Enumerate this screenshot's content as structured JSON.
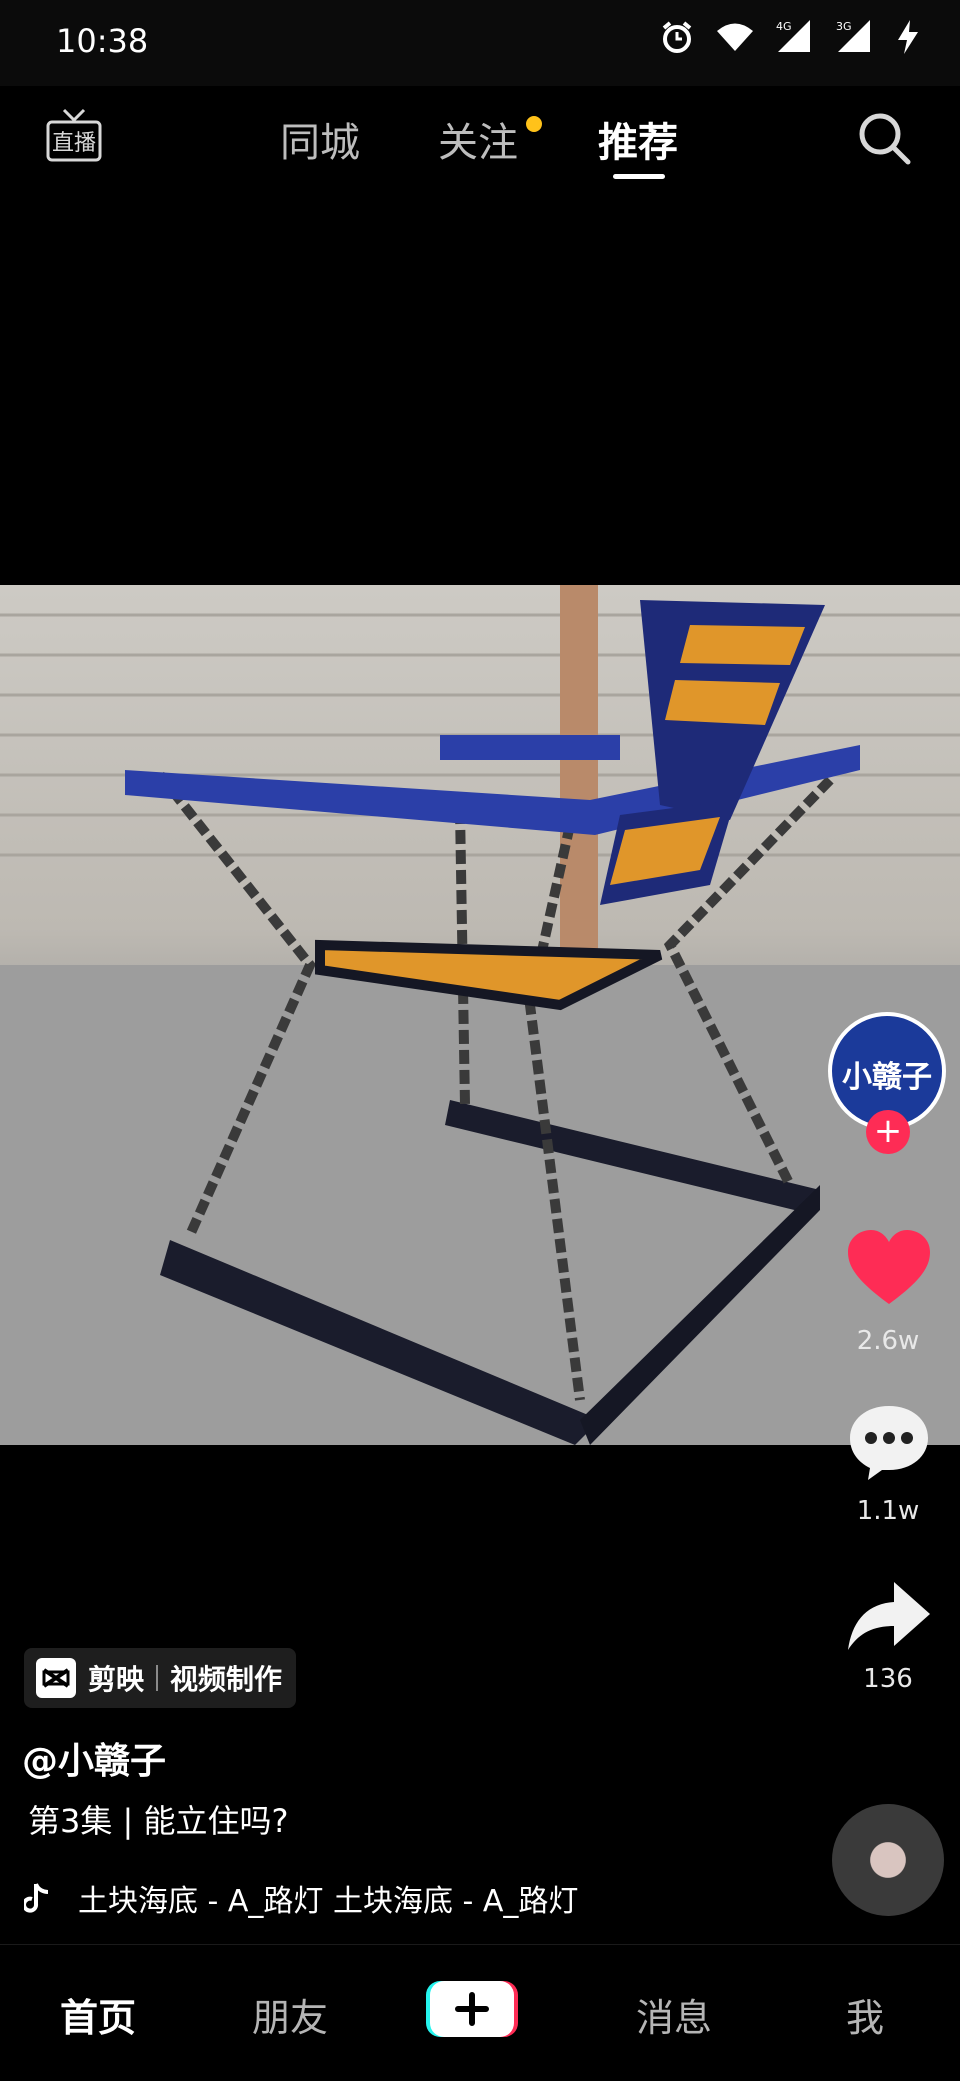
{
  "status": {
    "time": "10:38",
    "net1": "4G",
    "net2": "3G"
  },
  "top_nav": {
    "live_label": "直播",
    "tabs": [
      "同城",
      "关注",
      "推荐"
    ],
    "active_tab": "推荐"
  },
  "video": {
    "creator_avatar_text": "小赣子"
  },
  "actions": {
    "likes": "2.6w",
    "comments": "1.1w",
    "shares": "136"
  },
  "capcut": {
    "name": "剪映",
    "desc": "视频制作"
  },
  "post": {
    "username": "@小赣子",
    "caption": "第3集 | 能立住吗?",
    "music": "土块海底 - A_路灯    土块海底 - A_路灯"
  },
  "bottom_nav": {
    "home": "首页",
    "friends": "朋友",
    "messages": "消息",
    "me": "我"
  },
  "colors": {
    "accent": "#fe2c55",
    "dot": "#ffc21a",
    "chair_frame": "#2b3fa8",
    "wood": "#e0962a"
  }
}
